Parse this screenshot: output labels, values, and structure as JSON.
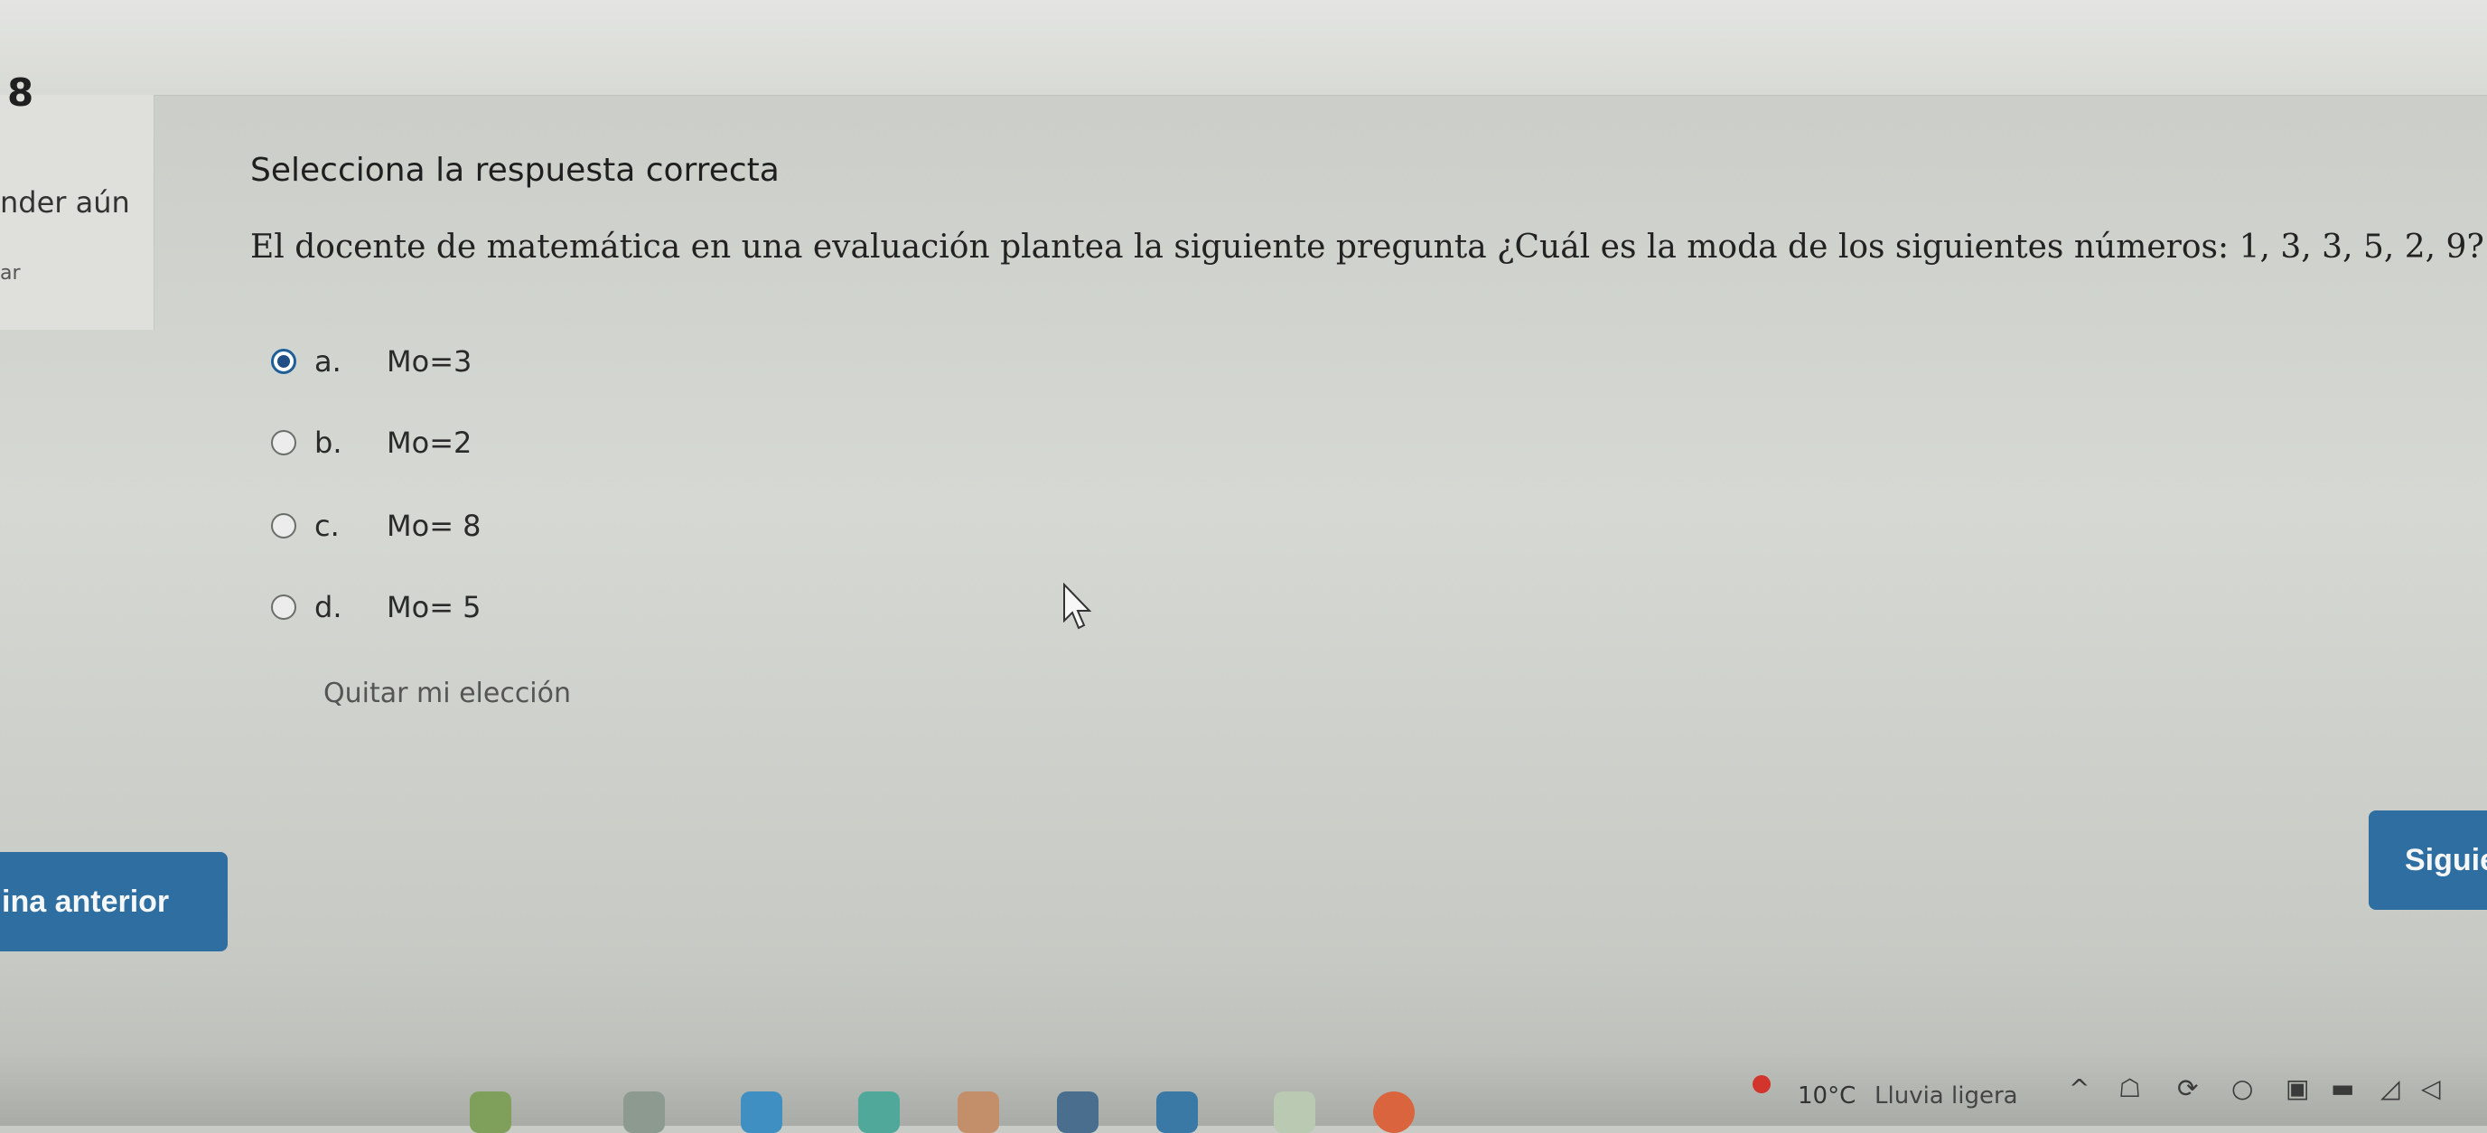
{
  "question": {
    "number": "8",
    "status": "nder aún",
    "flag": "ar",
    "prompt": "Selecciona la respuesta correcta",
    "text": "El docente de matemática en una evaluación plantea la siguiente pregunta ¿Cuál es la moda de los siguientes números: 1, 3, 3, 5, 2, 9?"
  },
  "options": [
    {
      "letter": "a.",
      "text": "Mo=3",
      "selected": true
    },
    {
      "letter": "b.",
      "text": "Mo=2",
      "selected": false
    },
    {
      "letter": "c.",
      "text": "Mo= 8",
      "selected": false
    },
    {
      "letter": "d.",
      "text": "Mo= 5",
      "selected": false
    }
  ],
  "clear_choice": "Quitar mi elección",
  "nav": {
    "prev_label": "ina anterior",
    "next_label": "Siguie"
  },
  "taskbar": {
    "weather_temp": "10°C",
    "weather_desc": "Lluvia ligera",
    "tray_icons": [
      "chevron-up-icon",
      "network-icon",
      "sync-icon",
      "cloud-icon",
      "keyboard-icon",
      "battery-icon",
      "wifi-icon",
      "volume-icon"
    ]
  },
  "colors": {
    "accent": "#2e6ea1",
    "radio_selected": "#1f4f85",
    "weather_alert": "#d1352b"
  }
}
